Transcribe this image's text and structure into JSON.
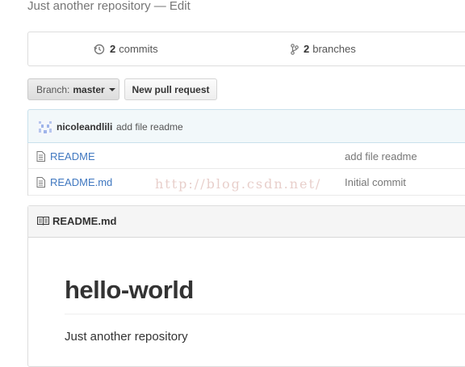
{
  "repo": {
    "description": "Just another repository",
    "separator": "—",
    "edit_label": "Edit"
  },
  "summary": {
    "commits_count": "2",
    "commits_label": "commits",
    "branches_count": "2",
    "branches_label": "branches"
  },
  "toolbar": {
    "branch_label": "Branch:",
    "branch_value": "master",
    "new_pr_label": "New pull request"
  },
  "latest_commit": {
    "author": "nicoleandlili",
    "message": "add file readme"
  },
  "files": [
    {
      "name": "README",
      "message": "add file readme"
    },
    {
      "name": "README.md",
      "message": "Initial commit"
    }
  ],
  "watermark": "http://blog.csdn.net/",
  "readme": {
    "header_title": "README.md",
    "heading": "hello-world",
    "body_text": "Just another repository"
  },
  "colors": {
    "link": "#4078c0",
    "commit_tease_bg": "#f2f8fa",
    "border": "#dddddd"
  },
  "icons": [
    "history-icon",
    "branch-icon",
    "file-icon",
    "book-icon",
    "avatar"
  ]
}
